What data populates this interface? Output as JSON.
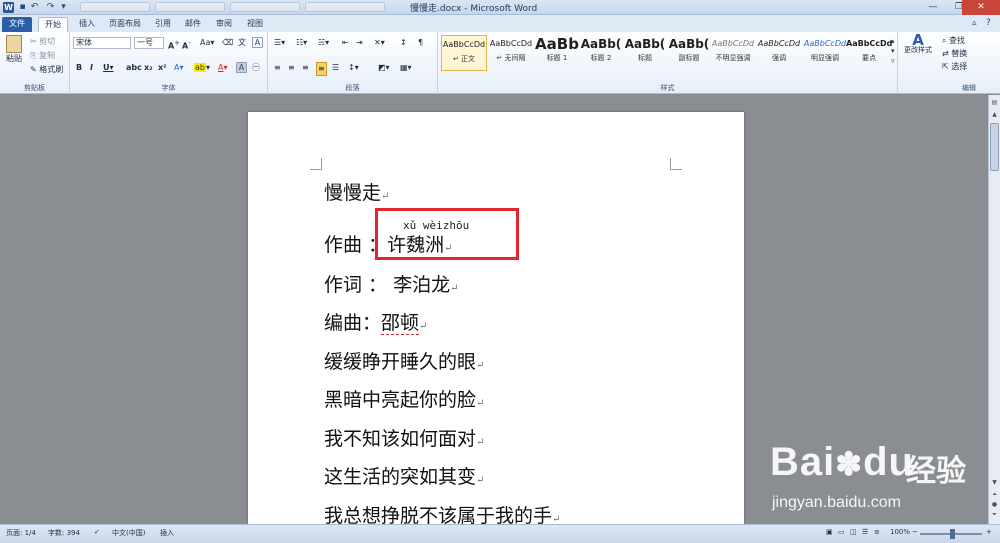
{
  "window": {
    "title": "慢慢走.docx - Microsoft Word",
    "app_icon": "W"
  },
  "tabs": {
    "file": "文件",
    "home": "开始",
    "insert": "插入",
    "layout": "页面布局",
    "references": "引用",
    "mailings": "邮件",
    "review": "审阅",
    "view": "视图"
  },
  "ribbon": {
    "clipboard": {
      "paste": "粘贴",
      "cut": "剪切",
      "copy": "复制",
      "format_painter": "格式刷",
      "group_label": "剪贴板"
    },
    "font": {
      "font_name": "宋体",
      "font_size": "一号",
      "group_label": "字体"
    },
    "paragraph": {
      "group_label": "段落"
    },
    "styles": {
      "group_label": "样式",
      "cards": [
        {
          "sample": "AaBbCcDd",
          "label": "正文"
        },
        {
          "sample": "AaBbCcDd",
          "label": "无间隔"
        },
        {
          "sample": "AaBb",
          "label": "标题 1"
        },
        {
          "sample": "AaBb(",
          "label": "标题 2"
        },
        {
          "sample": "AaBb(",
          "label": "标题"
        },
        {
          "sample": "AaBb(",
          "label": "副标题"
        },
        {
          "sample": "AaBbCcDd",
          "label": "不明显强调"
        },
        {
          "sample": "AaBbCcDd",
          "label": "强调"
        },
        {
          "sample": "AaBbCcDd",
          "label": "明显强调"
        },
        {
          "sample": "AaBbCcDd",
          "label": "要点"
        }
      ],
      "change_styles": "更改样式"
    },
    "editing": {
      "find": "查找",
      "replace": "替换",
      "select": "选择",
      "group_label": "编辑"
    }
  },
  "document": {
    "lines": [
      "慢慢走",
      "作曲",
      "许魏洲",
      "作词 ： 李泊龙",
      "编曲：",
      "邵顿",
      "缓缓睁开睡久的眼",
      "黑暗中亮起你的脸",
      "我不知该如何面对",
      "这生活的突如其变",
      "我总想挣脱不该属于我的手"
    ],
    "colon_spaced": "：",
    "pinyin": "xǔ wèizhōu",
    "paragraph_mark": "↵"
  },
  "statusbar": {
    "page": "页面: 1/4",
    "words": "字数: 394",
    "language": "中文(中国)",
    "insert_mode": "插入",
    "zoom": "100%"
  },
  "watermark": {
    "logo": "Bai",
    "logo_tail": "du",
    "cn": "经验",
    "url": "jingyan.baidu.com"
  },
  "colors": {
    "highlight_box": "#e3262e",
    "file_tab": "#2a5ea8"
  }
}
